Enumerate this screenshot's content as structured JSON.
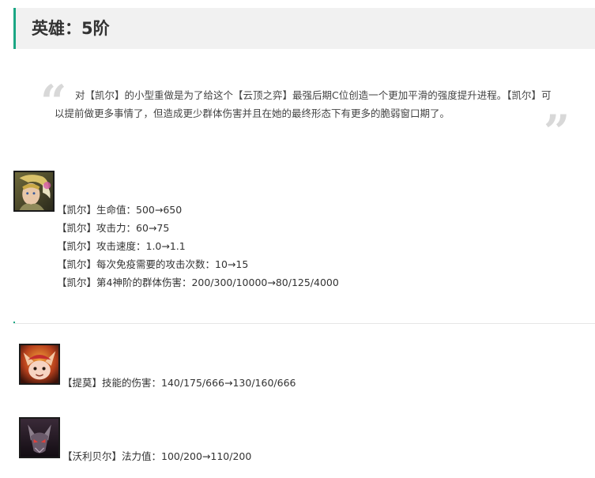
{
  "section": {
    "title": "英雄：5阶"
  },
  "quote": {
    "open_mark": "“",
    "close_mark": "”",
    "text": "对【凯尔】的小型重做是为了给这个【云顶之弈】最强后期C位创造一个更加平滑的强度提升进程。【凯尔】可以提前做更多事情了，但造成更少群体伤害并且在她的最终形态下有更多的脆弱窗口期了。"
  },
  "champions": [
    {
      "icon": "kayle-portrait-icon",
      "lines": [
        "【凯尔】生命值：500→650",
        "【凯尔】攻击力：60→75",
        "【凯尔】攻击速度：1.0→1.1",
        "【凯尔】每次免疫需要的攻击次数：10→15",
        "【凯尔】第4神阶的群体伤害：200/300/10000→80/125/4000"
      ]
    },
    {
      "icon": "teemo-portrait-icon",
      "lines": [
        "【提莫】技能的伤害：140/175/666→130/160/666"
      ]
    },
    {
      "icon": "velkoz-portrait-icon",
      "lines": [
        "【沃利贝尔】法力值：100/200→110/200"
      ]
    }
  ]
}
